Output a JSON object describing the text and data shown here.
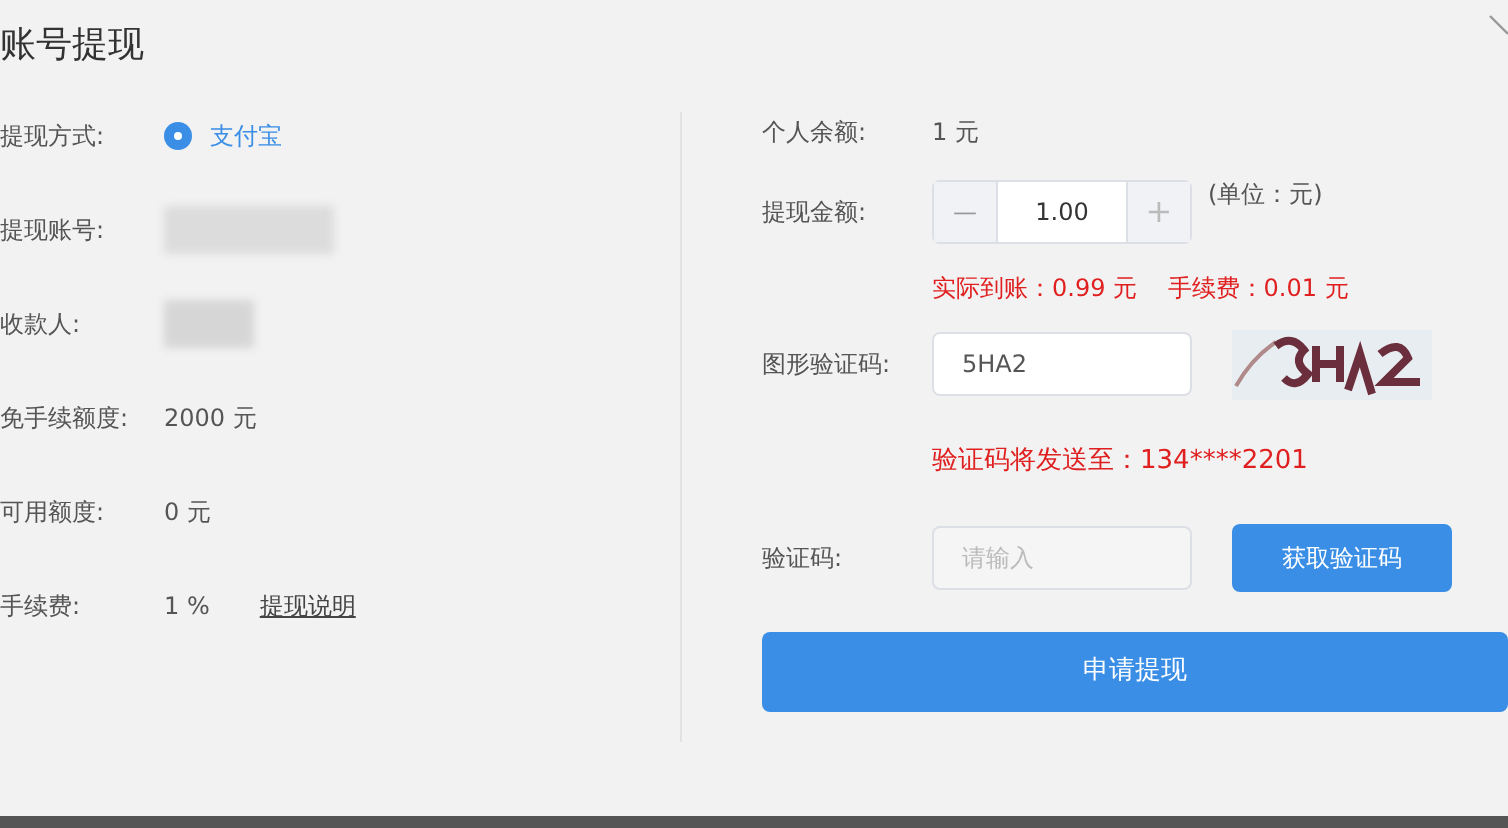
{
  "dialog": {
    "title": "账号提现"
  },
  "left": {
    "rows": [
      {
        "kind": "radio",
        "label": "提现方式:",
        "options": [
          {
            "label": "支付宝",
            "selected": true
          }
        ]
      },
      {
        "kind": "masked",
        "label": "提现账号:"
      },
      {
        "kind": "masked",
        "label": "收款人:"
      },
      {
        "kind": "text",
        "label": "免手续额度:",
        "value": "2000 元"
      },
      {
        "kind": "text",
        "label": "可用额度:",
        "value": "0 元"
      },
      {
        "kind": "text",
        "label": "手续费:",
        "value": "1 %",
        "link": "提现说明"
      }
    ]
  },
  "right": {
    "balance": {
      "label": "个人余额:",
      "value": "1 元"
    },
    "amount": {
      "label": "提现金额:",
      "value": "1.00",
      "unit": "(单位：元)",
      "minus": "—",
      "plus": "+",
      "note": "实际到账：0.99 元    手续费：0.01 元"
    },
    "captcha": {
      "label": "图形验证码:",
      "value": "5HA2",
      "note": "验证码将发送至：134****2201"
    },
    "sms": {
      "label": "验证码:",
      "placeholder": "请输入",
      "button": "获取验证码"
    },
    "submit": "申请提现"
  }
}
